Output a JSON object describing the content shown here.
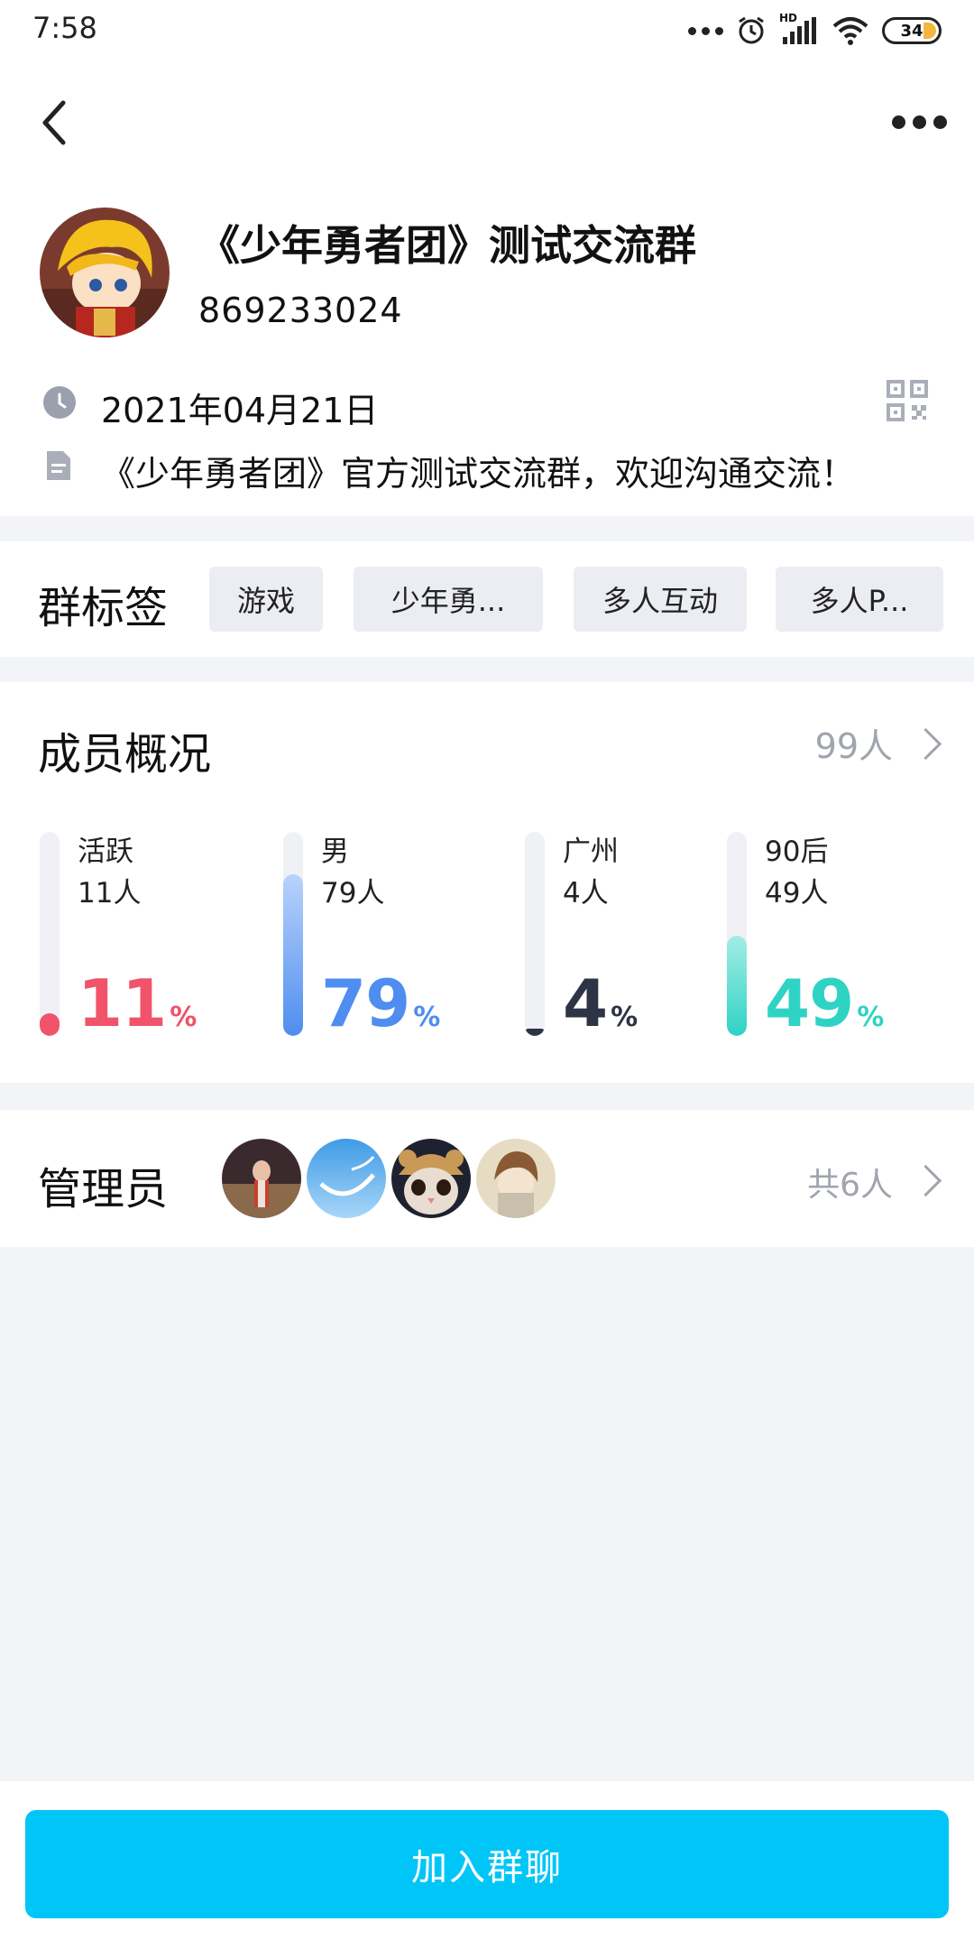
{
  "status_bar": {
    "time": "7:58",
    "battery": "34",
    "network": "HD"
  },
  "header": {
    "back_icon": "back-arrow-icon",
    "more_icon": "more-dots-icon"
  },
  "group": {
    "name": "《少年勇者团》测试交流群",
    "id": "869233024",
    "created_date": "2021年04月21日",
    "description": "《少年勇者团》官方测试交流群，欢迎沟通交流！"
  },
  "tags": {
    "title": "群标签",
    "items": [
      "游戏",
      "少年勇...",
      "多人互动",
      "多人P..."
    ]
  },
  "members": {
    "title": "成员概况",
    "count": "99人",
    "stats": [
      {
        "label": "活跃",
        "count": "11人",
        "value": "11",
        "unit": "%",
        "fraction": 0.11,
        "color": "#f0536a"
      },
      {
        "label": "男",
        "count": "79人",
        "value": "79",
        "unit": "%",
        "fraction": 0.79,
        "color": "#4f8df0"
      },
      {
        "label": "广州",
        "count": "4人",
        "value": "4",
        "unit": "%",
        "fraction": 0.04,
        "color": "#2e3445"
      },
      {
        "label": "90后",
        "count": "49人",
        "value": "49",
        "unit": "%",
        "fraction": 0.49,
        "color": "#2ed3c4"
      }
    ]
  },
  "admins": {
    "title": "管理员",
    "total": "共6人",
    "avatars": [
      "admin-avatar-1",
      "admin-avatar-2",
      "admin-avatar-3",
      "admin-avatar-4"
    ]
  },
  "footer": {
    "join_label": "加入群聊",
    "accent": "#00c6f7"
  }
}
